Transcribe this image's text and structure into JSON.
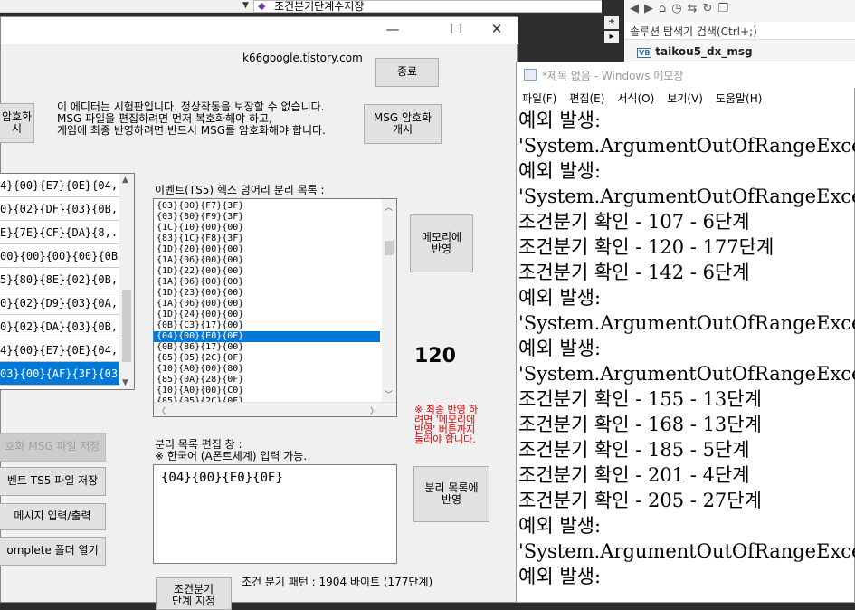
{
  "vs": {
    "combo2_text": "조건분기단계수저장",
    "toolbar_icons": [
      "back-icon",
      "forward-icon",
      "home-icon",
      "history-icon",
      "sync-icon",
      "refresh-icon",
      "copy-icon"
    ],
    "search_placeholder": "솔루션 탐색기 검색(Ctrl+;)",
    "project_badge": "VB",
    "project_name": "taikou5_dx_msg"
  },
  "app": {
    "blog": "k66google.tistory.com",
    "exit_label": "종료",
    "decrypt_label": "암호화\n시",
    "notice": "이 에디터는 시험판입니다. 정상작동을 보장할 수 없습니다.\nMSG 파일을 편집하려면 먼저 복호화해야 하고,\n게임에 최종 반영하려면 반드시 MSG를 암호화해야 합니다.",
    "encrypt_label": "MSG 암호화\n개시",
    "left_list": [
      "4}{00}{E7}{0E}{04,...",
      "0}{02}{DF}{03}{0B,...",
      "E}{7E}{CF}{DA}{8,...",
      "00}{00}{00}{00}{0B,...",
      "5}{80}{8E}{02}{0B,...",
      "0}{02}{D9}{03}{0A,...",
      "0}{02}{DA}{03}{0B,...",
      "4}{00}{E7}{0E}{04,...",
      "03}{00}{AF}{3F}{03,..."
    ],
    "left_selected": 8,
    "hex_title": "이벤트(TS5) 헥스 덩어리 분리 목록 :",
    "hex_rows": [
      "{03}{00}{F7}{3F}",
      "{03}{80}{F9}{3F}",
      "{1C}{10}{00}{00}",
      "{83}{1C}{F8}{3F}",
      "{1D}{20}{00}{00}",
      "{1A}{06}{00}{00}",
      "{1D}{22}{00}{00}",
      "{1A}{06}{00}{00}",
      "{1D}{23}{00}{00}",
      "{1A}{06}{00}{00}",
      "{1D}{24}{00}{00}",
      "{0B}{C3}{17}{00}",
      "{04}{00}{E0}{0E}",
      "{0B}{86}{17}{00}",
      "{85}{05}{2C}{0F}",
      "{10}{A0}{00}{80}",
      "{85}{0A}{28}{0F}",
      "{10}{A0}{00}{C0}",
      "{85}{05}{2C}{0E}"
    ],
    "hex_selected": 12,
    "memory_label": "메모리에\n반영",
    "count": "120",
    "warn": "※ 최종 반영 하\n려면 '메모리에\n반영' 버튼까지\n눌러야 합니다.",
    "save_msg": "호화 MSG 파일 저장",
    "save_ts5": "벤트 TS5 파일 저장",
    "msg_io": "메시지 입력/출력",
    "complete_folder": "omplete 폴더 열기",
    "edit_title": "분리 목록 편집 창 :",
    "edit_note": "※ 한국어 (A폰트체계) 입력 가능.",
    "edit_value": "{04}{00}{E0}{0E}",
    "apply_label": "분리 목록에\n반영",
    "cond_btn": "조건분기\n단계 지정",
    "pattern": "조건 분기 패턴 : 1904 바이트 (177단계)"
  },
  "notepad": {
    "title": "*제목 없음 - Windows 메모장",
    "menu": [
      "파일(F)",
      "편집(E)",
      "서식(O)",
      "보기(V)",
      "도움말(H)"
    ],
    "lines": [
      "예외 발생:",
      "'System.ArgumentOutOfRangeExcep",
      "예외 발생:",
      "'System.ArgumentOutOfRangeExcep",
      "조건분기 확인 - 107 - 6단계",
      "조건분기 확인 - 120 - 177단계",
      "조건분기 확인 - 142 - 6단계",
      "예외 발생:",
      "'System.ArgumentOutOfRangeExcep",
      "예외 발생:",
      "'System.ArgumentOutOfRangeExcep",
      "조건분기 확인 - 155 - 13단계",
      "조건분기 확인 - 168 - 13단계",
      "조건분기 확인 - 185 - 5단계",
      "조건분기 확인 - 201 - 4단계",
      "조건분기 확인 - 205 - 27단계",
      "예외 발생:",
      "'System.ArgumentOutOfRangeExcep",
      "예외 발생:"
    ]
  },
  "colors": {
    "selection": "#0078d7",
    "warning": "#e00000"
  }
}
